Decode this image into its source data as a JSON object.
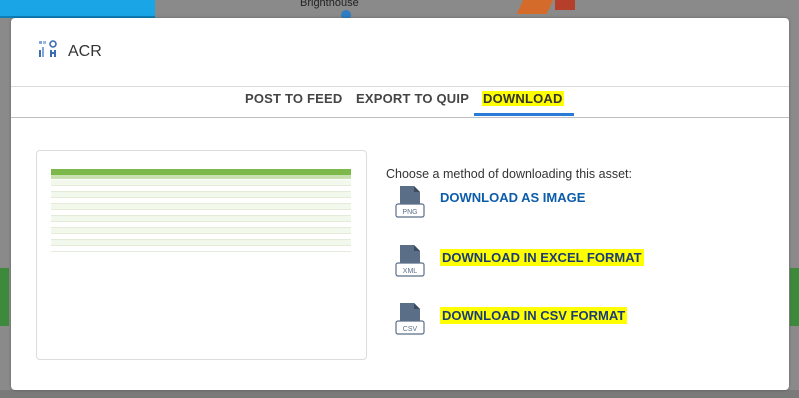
{
  "background": {
    "location_label": "Brighthouse"
  },
  "modal": {
    "title": "ACR",
    "tabs": [
      {
        "label": "POST TO FEED",
        "active": false
      },
      {
        "label": "EXPORT TO QUIP",
        "active": false
      },
      {
        "label": "DOWNLOAD",
        "active": true
      }
    ],
    "instructions": "Choose a method of downloading this asset:",
    "options": [
      {
        "label": "DOWNLOAD AS IMAGE",
        "file_badge": "PNG",
        "icon": "png-file-icon",
        "highlighted": false
      },
      {
        "label": "DOWNLOAD IN EXCEL FORMAT",
        "file_badge": "XML",
        "icon": "xml-file-icon",
        "highlighted": true
      },
      {
        "label": "DOWNLOAD IN CSV FORMAT",
        "file_badge": "CSV",
        "icon": "csv-file-icon",
        "highlighted": true
      }
    ]
  },
  "colors": {
    "accent": "#2a7bd6",
    "link": "#0b5cab",
    "highlight": "#ffff00",
    "sheet_header": "#7db84a"
  }
}
